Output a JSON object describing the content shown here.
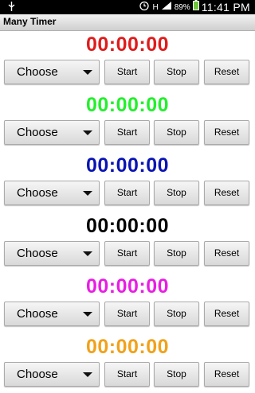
{
  "status_bar": {
    "usb_icon": "usb-icon",
    "alarm_icon": "alarm-icon",
    "network_type": "H",
    "battery_percent": "89%",
    "time": "11:41 PM"
  },
  "app": {
    "title": "Many Timer"
  },
  "controls": {
    "choose_label": "Choose",
    "start_label": "Start",
    "stop_label": "Stop",
    "reset_label": "Reset"
  },
  "timers": [
    {
      "display": "00:00:00",
      "color": "#e01b1b"
    },
    {
      "display": "00:00:00",
      "color": "#22f02c"
    },
    {
      "display": "00:00:00",
      "color": "#0a14b4"
    },
    {
      "display": "00:00:00",
      "color": "#000000"
    },
    {
      "display": "00:00:00",
      "color": "#e81ee3"
    },
    {
      "display": "00:00:00",
      "color": "#f2a11a"
    }
  ]
}
